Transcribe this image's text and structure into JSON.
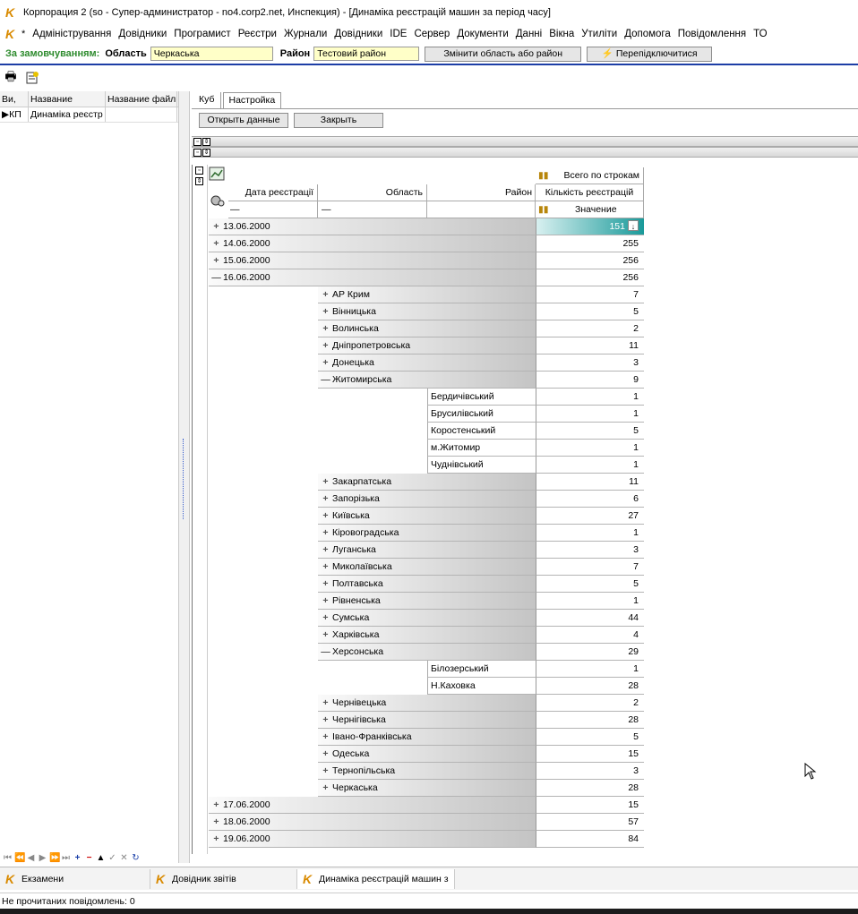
{
  "window": {
    "title": "Корпорация 2 (so - Супер-администратор - no4.corp2.net, Инспекция) - [Динаміка реєстрацій машин за період часу]"
  },
  "menu": {
    "star": "*",
    "items": [
      "Адміністрування",
      "Довідники",
      "Програмист",
      "Реєстри",
      "Журнали",
      "Довідники",
      "IDE",
      "Сервер",
      "Документи",
      "Данні",
      "Вікна",
      "Утиліти",
      "Допомога",
      "Повідомлення",
      "ТО"
    ]
  },
  "scope": {
    "label": "За замовчуванням:",
    "region_label": "Область",
    "region_value": "Черкаська",
    "district_label": "Район",
    "district_value": "Тестовий район",
    "change_button": "Змінити область або район",
    "reconnect_button": "Перепідключитися"
  },
  "left": {
    "columns": [
      "Ви,",
      "Название",
      "Название файл"
    ],
    "row": {
      "code": "КП",
      "name": "Динаміка реєстр"
    }
  },
  "tabs": [
    "Куб",
    "Настройка"
  ],
  "actions": {
    "open": "Открыть данные",
    "close": "Закрыть"
  },
  "pivot": {
    "header": {
      "col_date": "Дата реєстрації",
      "col_region": "Область",
      "col_district": "Район",
      "total_label": "Всего по строкам",
      "measure": "Кількість реєстрацій",
      "value_label": "Значение"
    },
    "rows": [
      {
        "level": 0,
        "exp": "+",
        "label": "13.06.2000",
        "value": "151",
        "selected": true
      },
      {
        "level": 0,
        "exp": "+",
        "label": "14.06.2000",
        "value": "255"
      },
      {
        "level": 0,
        "exp": "+",
        "label": "15.06.2000",
        "value": "256"
      },
      {
        "level": 0,
        "exp": "—",
        "label": "16.06.2000",
        "value": "256"
      },
      {
        "level": 1,
        "exp": "+",
        "label": "АР Крим",
        "value": "7"
      },
      {
        "level": 1,
        "exp": "+",
        "label": "Вінницька",
        "value": "5"
      },
      {
        "level": 1,
        "exp": "+",
        "label": "Волинська",
        "value": "2"
      },
      {
        "level": 1,
        "exp": "+",
        "label": "Дніпропетровська",
        "value": "11"
      },
      {
        "level": 1,
        "exp": "+",
        "label": "Донецька",
        "value": "3"
      },
      {
        "level": 1,
        "exp": "—",
        "label": "Житомирська",
        "value": "9"
      },
      {
        "level": 2,
        "exp": "",
        "label": "Бердичівський",
        "value": "1"
      },
      {
        "level": 2,
        "exp": "",
        "label": "Брусилівський",
        "value": "1"
      },
      {
        "level": 2,
        "exp": "",
        "label": "Коростенський",
        "value": "5"
      },
      {
        "level": 2,
        "exp": "",
        "label": "м.Житомир",
        "value": "1"
      },
      {
        "level": 2,
        "exp": "",
        "label": "Чуднівський",
        "value": "1"
      },
      {
        "level": 1,
        "exp": "+",
        "label": "Закарпатська",
        "value": "11"
      },
      {
        "level": 1,
        "exp": "+",
        "label": "Запорізька",
        "value": "6"
      },
      {
        "level": 1,
        "exp": "+",
        "label": "Київська",
        "value": "27"
      },
      {
        "level": 1,
        "exp": "+",
        "label": "Кіровоградська",
        "value": "1"
      },
      {
        "level": 1,
        "exp": "+",
        "label": "Луганська",
        "value": "3"
      },
      {
        "level": 1,
        "exp": "+",
        "label": "Миколаївська",
        "value": "7"
      },
      {
        "level": 1,
        "exp": "+",
        "label": "Полтавська",
        "value": "5"
      },
      {
        "level": 1,
        "exp": "+",
        "label": "Рівненська",
        "value": "1"
      },
      {
        "level": 1,
        "exp": "+",
        "label": "Сумська",
        "value": "44"
      },
      {
        "level": 1,
        "exp": "+",
        "label": "Харківська",
        "value": "4"
      },
      {
        "level": 1,
        "exp": "—",
        "label": "Херсонська",
        "value": "29"
      },
      {
        "level": 2,
        "exp": "",
        "label": "Білозерський",
        "value": "1"
      },
      {
        "level": 2,
        "exp": "",
        "label": "Н.Каховка",
        "value": "28"
      },
      {
        "level": 1,
        "exp": "+",
        "label": "Чернівецька",
        "value": "2"
      },
      {
        "level": 1,
        "exp": "+",
        "label": "Чернігівська",
        "value": "28"
      },
      {
        "level": 1,
        "exp": "+",
        "label": "Івано-Франківська",
        "value": "5"
      },
      {
        "level": 1,
        "exp": "+",
        "label": "Одеська",
        "value": "15"
      },
      {
        "level": 1,
        "exp": "+",
        "label": "Тернопільська",
        "value": "3"
      },
      {
        "level": 1,
        "exp": "+",
        "label": "Черкаська",
        "value": "28"
      },
      {
        "level": 0,
        "exp": "+",
        "label": "17.06.2000",
        "value": "15"
      },
      {
        "level": 0,
        "exp": "+",
        "label": "18.06.2000",
        "value": "57"
      },
      {
        "level": 0,
        "exp": "+",
        "label": "19.06.2000",
        "value": "84"
      }
    ]
  },
  "taskbar": [
    "Екзамени",
    "Довідник звітів",
    "Динаміка реєстрацій машин з"
  ],
  "status": "Не прочитаних повідомлень: 0"
}
